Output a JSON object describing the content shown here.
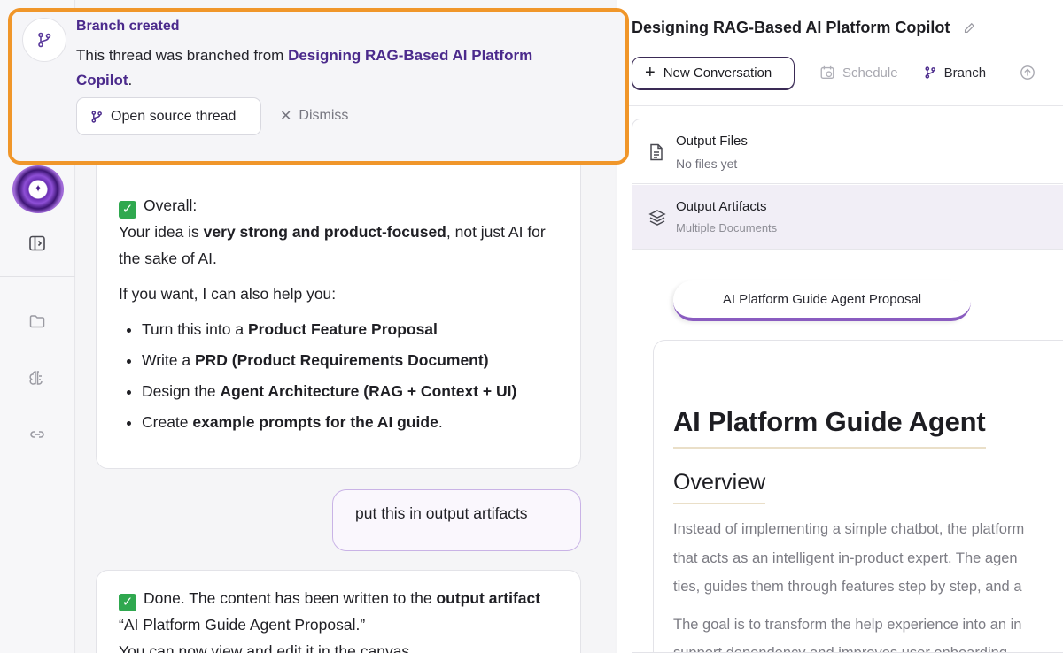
{
  "toast": {
    "title": "Branch created",
    "body_prefix": "This thread was branched from ",
    "source_name": "Designing RAG-Based AI Platform Copilot",
    "body_suffix": ".",
    "open_label": "Open source thread",
    "dismiss_label": "Dismiss"
  },
  "chat": {
    "msg1": {
      "overall_label": "Overall:",
      "line1_pre": "Your idea is ",
      "line1_bold": "very strong and product-focused",
      "line1_post": ", not just AI for the sake of AI.",
      "offer": "If you want, I can also help you:",
      "items": [
        {
          "pre": "Turn this into a ",
          "bold": "Product Feature Proposal",
          "post": ""
        },
        {
          "pre": "Write a ",
          "bold": "PRD (Product Requirements Document)",
          "post": ""
        },
        {
          "pre": "Design the ",
          "bold": "Agent Architecture (RAG + Context + UI)",
          "post": ""
        },
        {
          "pre": "Create ",
          "bold": "example prompts for the AI guide",
          "post": "."
        }
      ]
    },
    "user_msg": "put this in output artifacts",
    "msg2": {
      "pre": "Done. The content has been written to the ",
      "bold": "output artifact",
      "post": " “AI Platform Guide Agent Proposal.”",
      "line2": "You can now view and edit it in the canvas."
    }
  },
  "right": {
    "title": "Designing RAG-Based AI Platform Copilot",
    "toolbar": {
      "new_label": "New Conversation",
      "schedule_label": "Schedule",
      "branch_label": "Branch"
    },
    "files": {
      "name": "Output Files",
      "sub": "No files yet"
    },
    "artifacts": {
      "name": "Output Artifacts",
      "sub": "Multiple Documents"
    },
    "tab": "AI Platform Guide Agent Proposal",
    "doc": {
      "h1": "AI Platform Guide Agent",
      "h2": "Overview",
      "p1_lines": [
        "Instead of implementing a simple chatbot, the platform",
        "that acts as an intelligent in-product expert. The agen",
        "ties, guides them through features step by step, and a"
      ],
      "p2_lines": [
        "The goal is to transform the help experience into an in",
        "support dependency and improves user onboarding"
      ]
    }
  },
  "colors": {
    "accent_purple": "#4b2a8c",
    "highlight_orange": "#f0962a",
    "check_green": "#2fa84f"
  },
  "icons": [
    "branch-icon",
    "close-icon",
    "panel-toggle-icon",
    "folder-icon",
    "brain-icon",
    "link-icon",
    "plus-icon",
    "calendar-icon",
    "upload-icon",
    "document-icon",
    "layers-icon",
    "pencil-icon"
  ]
}
